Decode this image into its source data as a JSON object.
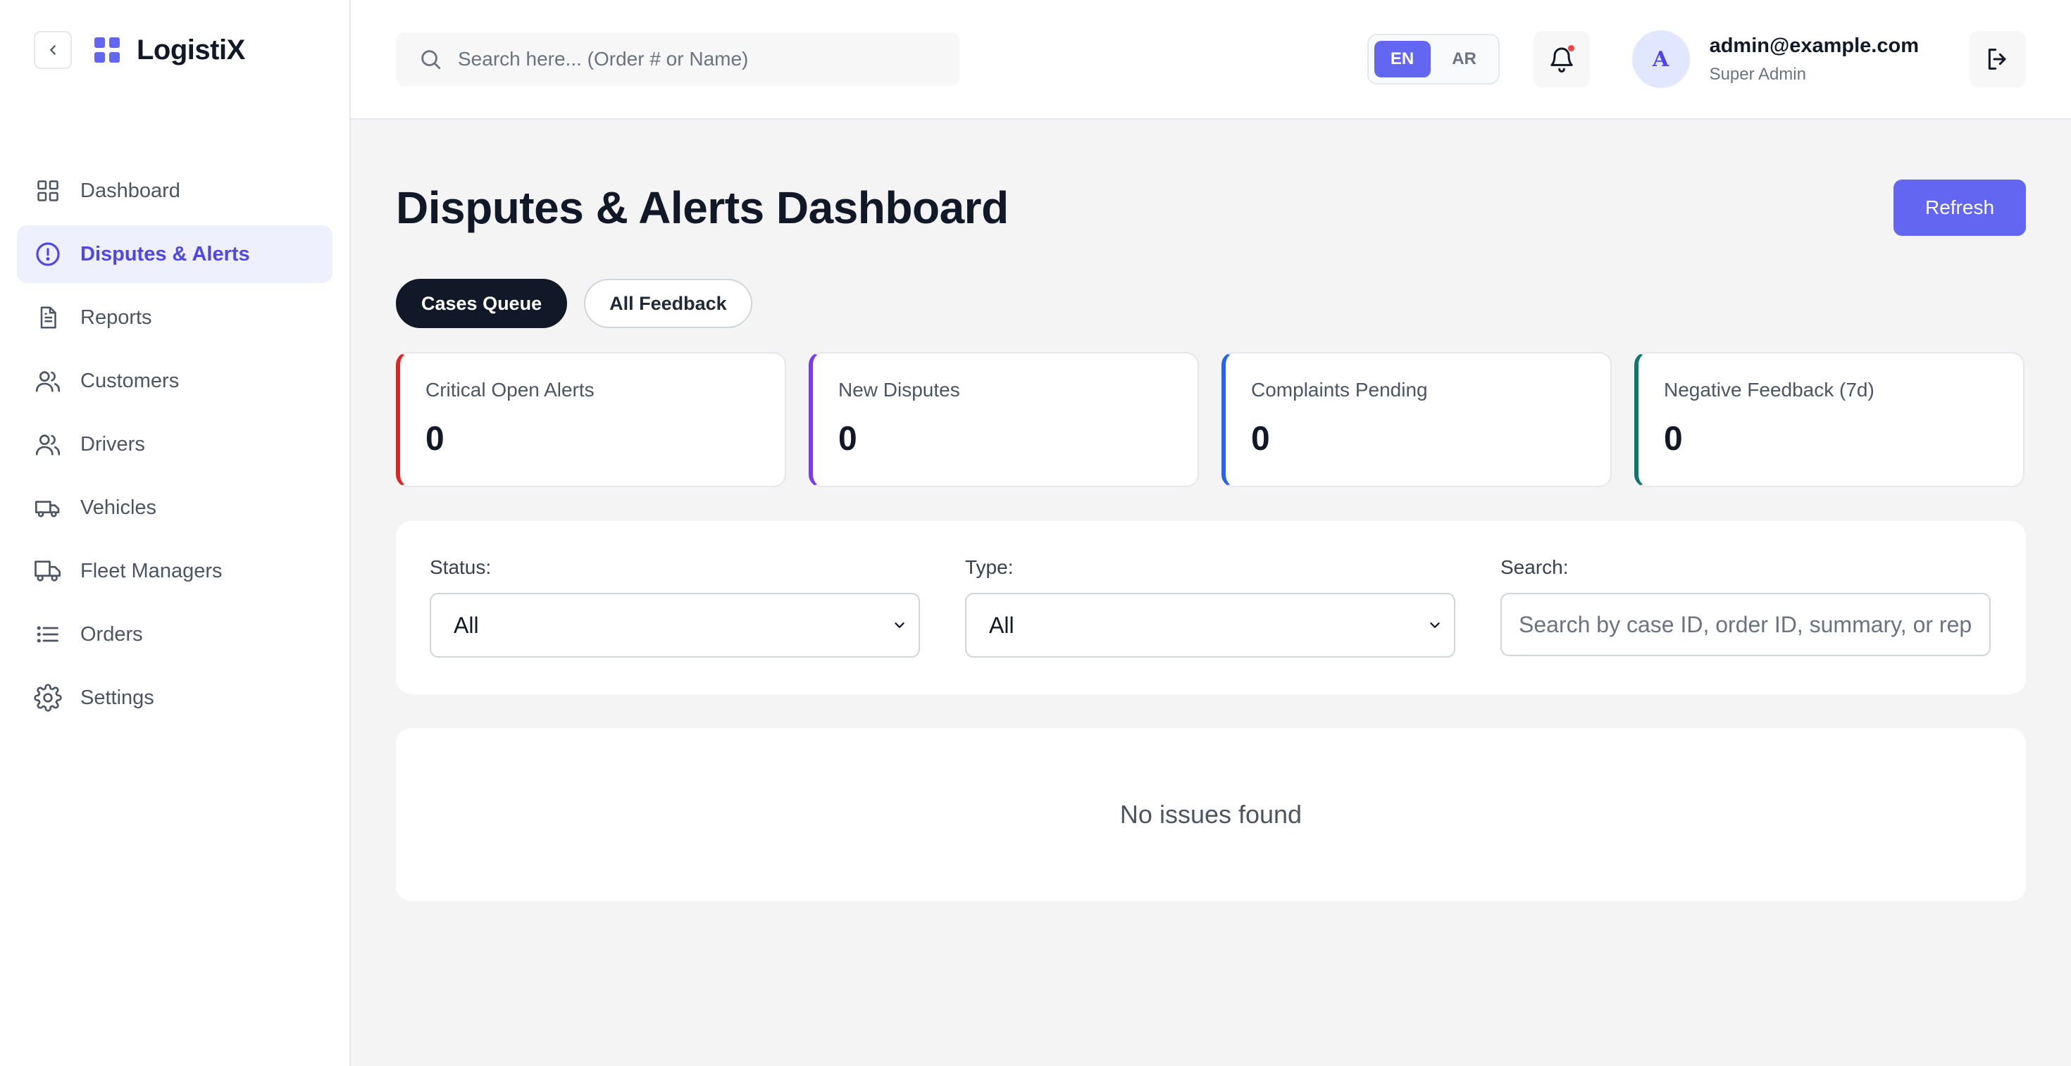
{
  "brand": {
    "name": "LogistiX",
    "accent": "#6366f1"
  },
  "sidebar": {
    "items": [
      {
        "label": "Dashboard",
        "icon": "grid-icon",
        "active": false
      },
      {
        "label": "Disputes & Alerts",
        "icon": "alert-circle-icon",
        "active": true
      },
      {
        "label": "Reports",
        "icon": "document-icon",
        "active": false
      },
      {
        "label": "Customers",
        "icon": "users-icon",
        "active": false
      },
      {
        "label": "Drivers",
        "icon": "users-icon",
        "active": false
      },
      {
        "label": "Vehicles",
        "icon": "truck-icon",
        "active": false
      },
      {
        "label": "Fleet Managers",
        "icon": "fleet-truck-icon",
        "active": false
      },
      {
        "label": "Orders",
        "icon": "list-icon",
        "active": false
      },
      {
        "label": "Settings",
        "icon": "gear-icon",
        "active": false
      }
    ]
  },
  "topbar": {
    "search_placeholder": "Search here... (Order # or Name)",
    "languages": [
      "EN",
      "AR"
    ],
    "active_language": "EN",
    "user": {
      "initial": "A",
      "email": "admin@example.com",
      "role": "Super Admin"
    }
  },
  "page": {
    "title": "Disputes & Alerts Dashboard",
    "refresh_label": "Refresh",
    "tabs": [
      {
        "label": "Cases Queue",
        "active": true
      },
      {
        "label": "All Feedback",
        "active": false
      }
    ],
    "stats": [
      {
        "label": "Critical Open Alerts",
        "value": "0",
        "color": "#dc2626"
      },
      {
        "label": "New Disputes",
        "value": "0",
        "color": "#7c3aed"
      },
      {
        "label": "Complaints Pending",
        "value": "0",
        "color": "#2563eb"
      },
      {
        "label": "Negative Feedback (7d)",
        "value": "0",
        "color": "#0f766e"
      }
    ],
    "filters": {
      "status_label": "Status:",
      "status_value": "All",
      "type_label": "Type:",
      "type_value": "All",
      "search_label": "Search:",
      "search_placeholder": "Search by case ID, order ID, summary, or reporter..."
    },
    "empty_message": "No issues found"
  }
}
